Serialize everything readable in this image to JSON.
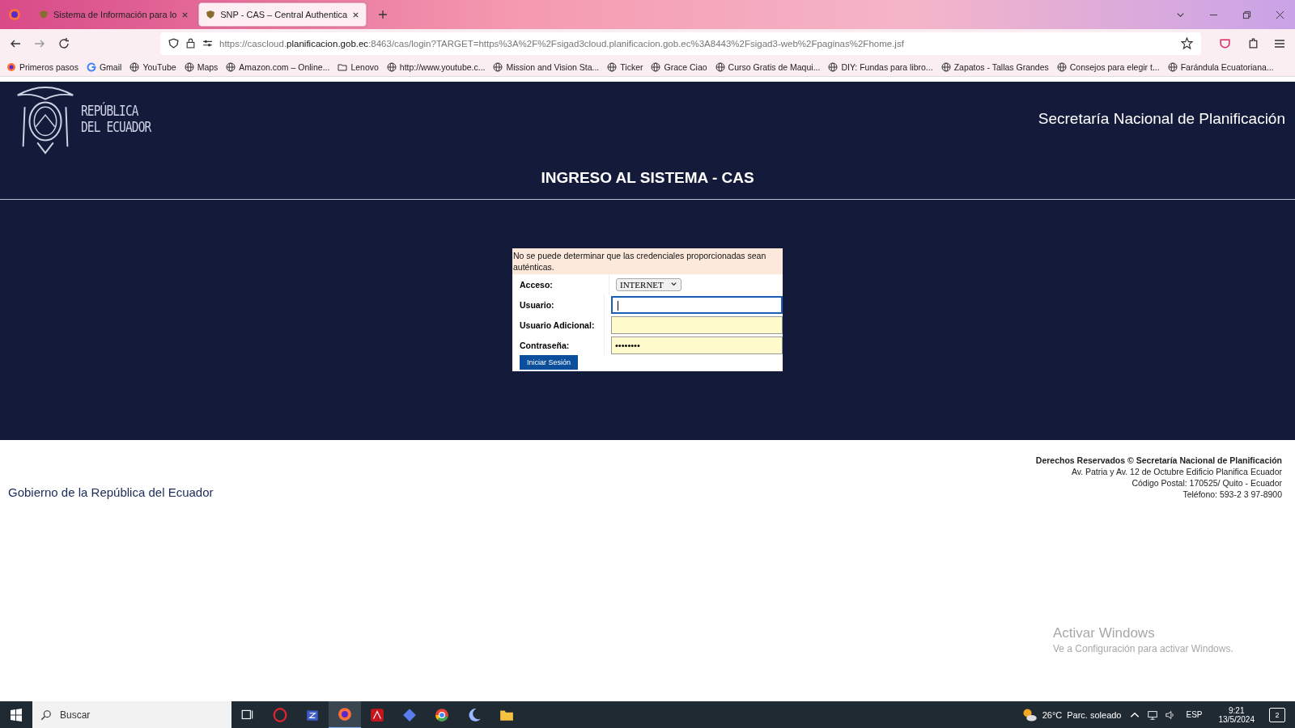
{
  "browser": {
    "tabs": [
      {
        "title": "Sistema de Información para lo",
        "selected": false
      },
      {
        "title": "SNP - CAS – Central Authentica",
        "selected": true
      }
    ],
    "url": [
      {
        "text": "https://cascloud.",
        "kind": "dim"
      },
      {
        "text": "planificacion.gob.ec",
        "kind": "host"
      },
      {
        "text": ":8463/cas/login?TARGET=https%3A%2F%2Fsigad3cloud.planificacion.gob.ec%3A8443%2Fsigad3-web%2Fpaginas%2Fhome.jsf",
        "kind": "dim"
      }
    ],
    "bookmarks": [
      {
        "label": "Primeros pasos",
        "kind": "firefox"
      },
      {
        "label": "Gmail",
        "kind": "google"
      },
      {
        "label": "YouTube",
        "kind": "globe"
      },
      {
        "label": "Maps",
        "kind": "globe"
      },
      {
        "label": "Amazon.com – Online...",
        "kind": "globe"
      },
      {
        "label": "Lenovo",
        "kind": "folder"
      },
      {
        "label": "http://www.youtube.c...",
        "kind": "globe"
      },
      {
        "label": "Mission and Vision Sta...",
        "kind": "globe"
      },
      {
        "label": "Ticker",
        "kind": "globe"
      },
      {
        "label": "Grace Ciao",
        "kind": "globe"
      },
      {
        "label": "Curso Gratis de Maqui...",
        "kind": "globe"
      },
      {
        "label": "DIY: Fundas para libro...",
        "kind": "globe"
      },
      {
        "label": "Zapatos - Tallas Grandes",
        "kind": "globe"
      },
      {
        "label": "Consejos para elegir t...",
        "kind": "globe"
      },
      {
        "label": "Farándula Ecuatoriana...",
        "kind": "globe"
      }
    ]
  },
  "header": {
    "logo_lines": [
      "REPÚBLICA",
      "DEL ECUADOR"
    ],
    "agency": "Secretaría Nacional de Planificación",
    "title": "INGRESO AL SISTEMA - CAS"
  },
  "login": {
    "error": "No se puede determinar que las credenciales proporcionadas sean auténticas.",
    "fields": [
      {
        "label": "Acceso:",
        "kind": "select",
        "value": "INTERNET"
      },
      {
        "label": "Usuario:",
        "kind": "text",
        "focused": true
      },
      {
        "label": "Usuario Adicional:",
        "kind": "text",
        "focused": false
      },
      {
        "label": "Contraseña:",
        "kind": "password",
        "value": "••••••••",
        "focused": false
      }
    ],
    "submit": "Iniciar Sesión"
  },
  "footer": {
    "government": "Gobierno de la República del Ecuador",
    "rights": "Derechos Reservados © Secretaría Nacional de Planificación",
    "address_lines": [
      "Av. Patria y Av. 12 de Octubre Edificio Planifica Ecuador",
      "Código Postal: 170525/ Quito - Ecuador",
      "Teléfono: 593-2 3 97-8900"
    ]
  },
  "activation": {
    "title": "Activar Windows",
    "subtitle": "Ve a Configuración para activar Windows."
  },
  "taskbar": {
    "search_placeholder": "Buscar",
    "weather": "26°C",
    "weather_text": "Parc. soleado",
    "language": "ESP",
    "time": "9:21",
    "date": "13/5/2024",
    "notifications": "2"
  }
}
